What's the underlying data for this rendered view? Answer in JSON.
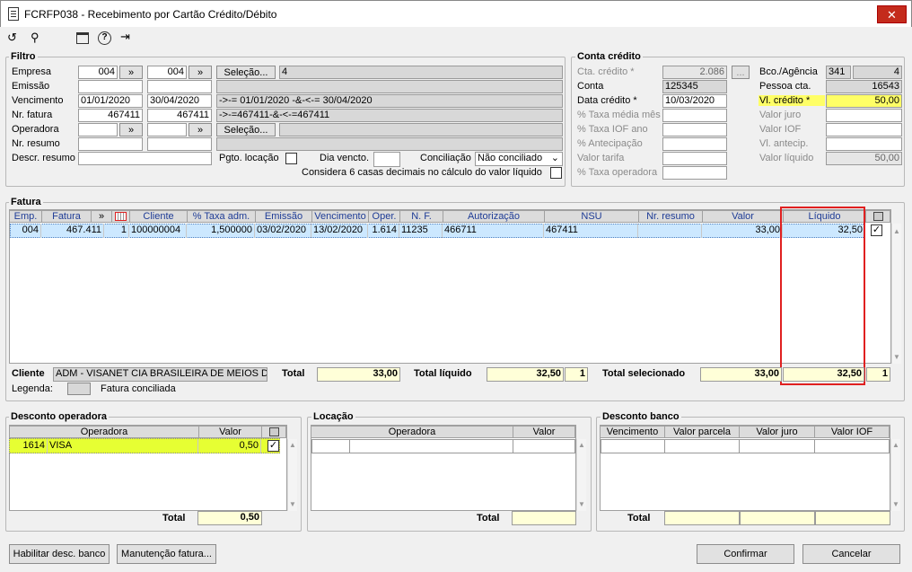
{
  "window": {
    "title": "FCRFP038 - Recebimento por Cartão Crédito/Débito"
  },
  "icons": {
    "window": "document-icon",
    "undo": "refresh-icon",
    "search": "search-icon",
    "calendar": "calendar-icon",
    "help": "help-icon",
    "exit": "exit-icon"
  },
  "filtro": {
    "title": "Filtro",
    "empresa_label": "Empresa",
    "emissao_label": "Emissão",
    "vencimento_label": "Vencimento",
    "nr_fatura_label": "Nr. fatura",
    "operadora_label": "Operadora",
    "nr_resumo_label": "Nr. resumo",
    "descr_resumo_label": "Descr. resumo",
    "empresa_from": "004",
    "empresa_to": "004",
    "vencimento_from": "01/01/2020",
    "vencimento_to": "30/04/2020",
    "fatura_from": "467411",
    "fatura_to": "467411",
    "selecao_label": "Seleção...",
    "empresa_result": "4",
    "vencimento_expr": "->-= 01/01/2020 -&-<-= 30/04/2020",
    "fatura_expr": "->-=467411-&-<-=467411",
    "nav_label": "»",
    "pgto_locacao_label": "Pgto. locação",
    "dia_vencto_label": "Dia vencto.",
    "conciliacao_label": "Conciliação",
    "conciliacao_value": "Não conciliado",
    "casas_label": "Considera 6 casas decimais no cálculo do valor líquido"
  },
  "conta": {
    "title": "Conta crédito",
    "cta_credito_label": "Cta. crédito *",
    "cta_credito": "2.086",
    "conta_label": "Conta",
    "conta": "125345",
    "data_credito_label": "Data crédito *",
    "data_credito": "10/03/2020",
    "taxa_media_label": "% Taxa média mês",
    "taxa_iof_label": "% Taxa IOF ano",
    "antecipacao_label": "% Antecipação",
    "valor_tarifa_label": "Valor tarifa",
    "taxa_operadora_label": "% Taxa operadora",
    "bco_label": "Bco./Agência",
    "banco": "341",
    "agencia": "4",
    "pessoa_label": "Pessoa cta.",
    "pessoa": "16543",
    "vl_credito_label": "Vl. crédito *",
    "vl_credito": "50,00",
    "valor_juro_label": "Valor juro",
    "valor_iof_label": "Valor IOF",
    "vl_antecip_label": "Vl. antecip.",
    "valor_liquido_label": "Valor líquido",
    "valor_liquido": "50,00",
    "lookup_label": "..."
  },
  "fatura": {
    "title": "Fatura",
    "columns": [
      "Emp.",
      "Fatura",
      "»",
      "",
      "Cliente",
      "% Taxa adm.",
      "Emissão",
      "Vencimento",
      "Oper.",
      "N. F.",
      "Autorização",
      "NSU",
      "Nr. resumo",
      "Valor",
      "Líquido",
      ""
    ],
    "row": {
      "emp": "004",
      "fatura": "467.411",
      "seq": "1",
      "cliente": "100000004",
      "taxa": "1,500000",
      "emissao": "03/02/2020",
      "vencimento": "13/02/2020",
      "oper": "1.614",
      "nf": "11235",
      "autorizacao": "466711",
      "nsu": "467411",
      "nr_resumo": "",
      "valor": "33,00",
      "liquido": "32,50"
    },
    "cliente_label": "Cliente",
    "cliente_nome": "ADM - VISANET CIA BRASILEIRA DE MEIOS DE PAGAMENTO",
    "total_label": "Total",
    "total": "33,00",
    "total_liquido_label": "Total líquido",
    "total_liquido": "32,50",
    "total_liquido_count": "1",
    "total_sel_label": "Total selecionado",
    "total_sel_valor": "33,00",
    "total_sel_liquido": "32,50",
    "total_sel_count": "1",
    "legenda_label": "Legenda:",
    "legenda_text": "Fatura conciliada"
  },
  "desconto_operadora": {
    "title": "Desconto operadora",
    "col_operadora": "Operadora",
    "col_valor": "Valor",
    "row_code": "1614",
    "row_name": "VISA",
    "row_valor": "0,50",
    "total_label": "Total",
    "total": "0,50"
  },
  "locacao": {
    "title": "Locação",
    "col_operadora": "Operadora",
    "col_valor": "Valor",
    "total_label": "Total"
  },
  "desconto_banco": {
    "title": "Desconto banco",
    "col_vencimento": "Vencimento",
    "col_parcela": "Valor parcela",
    "col_juro": "Valor juro",
    "col_iof": "Valor IOF",
    "total_label": "Total"
  },
  "buttons": {
    "habilitar": "Habilitar desc. banco",
    "manutencao": "Manutenção fatura...",
    "confirmar": "Confirmar",
    "cancelar": "Cancelar"
  },
  "colors": {
    "highlight_yellow": "#ffff66",
    "lime": "#e6ff33",
    "red_box": "#e02020",
    "row_selected": "#cce8ff"
  }
}
